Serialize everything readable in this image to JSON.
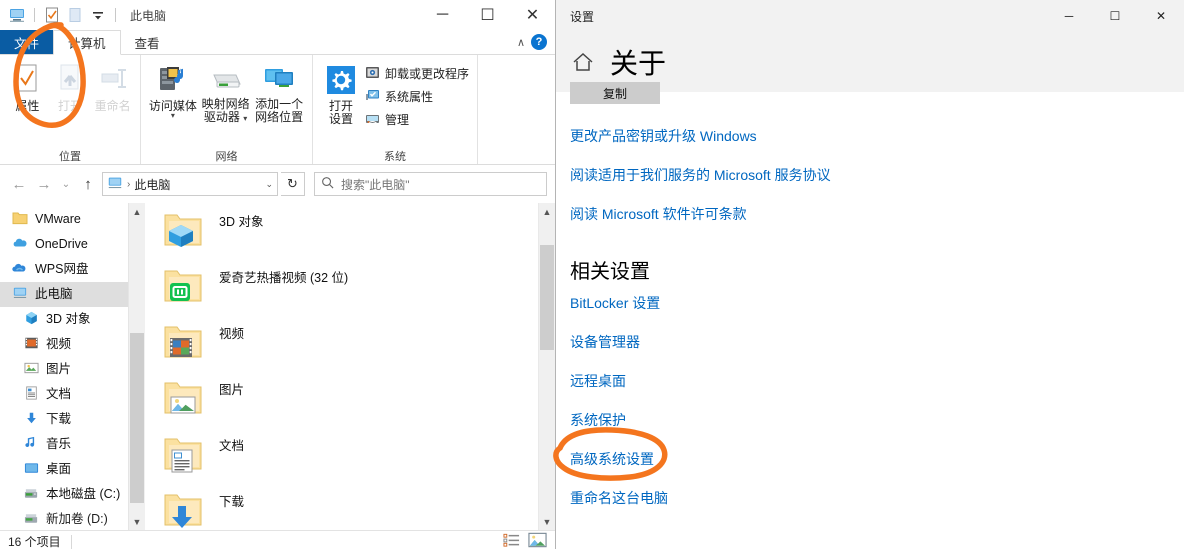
{
  "explorer": {
    "window_title": "此电脑",
    "quick_access_icons": [
      "this-pc-icon",
      "properties-checkbox-icon",
      "new-folder-icon",
      "customize-dropdown-icon"
    ],
    "window_buttons": {
      "minimize": "─",
      "maximize": "☐",
      "close": "✕"
    },
    "tabs": [
      {
        "label": "文件",
        "kind": "file"
      },
      {
        "label": "计算机",
        "kind": "active"
      },
      {
        "label": "查看",
        "kind": "normal"
      }
    ],
    "ribbon_collapse": "∧",
    "help_label": "?",
    "ribbon": {
      "groups": [
        {
          "label": "位置",
          "buttons": [
            {
              "label": "属性",
              "icon": "properties-icon",
              "disabled": false
            },
            {
              "label": "打开",
              "icon": "open-icon",
              "disabled": true
            },
            {
              "label": "重命名",
              "icon": "rename-icon",
              "disabled": true
            }
          ]
        },
        {
          "label": "网络",
          "buttons": [
            {
              "label": "访问媒体",
              "icon": "media-server-icon",
              "disabled": false,
              "dropdown": true
            },
            {
              "label": "映射网络\n驱动器",
              "icon": "map-drive-icon",
              "disabled": false,
              "dropdown": true
            },
            {
              "label": "添加一个\n网络位置",
              "icon": "add-network-location-icon",
              "disabled": false
            }
          ]
        },
        {
          "label": "系统",
          "big": {
            "label": "打开\n设置",
            "icon": "settings-gear-icon"
          },
          "items": [
            {
              "label": "卸载或更改程序",
              "icon": "uninstall-program-icon"
            },
            {
              "label": "系统属性",
              "icon": "system-properties-icon"
            },
            {
              "label": "管理",
              "icon": "manage-icon"
            }
          ]
        }
      ]
    },
    "addressbar": {
      "back": "←",
      "forward": "→",
      "recent": "⌄",
      "up": "↑",
      "path_icon": "this-pc-icon",
      "path": "此电脑",
      "separator": "›",
      "dropdown": "⌄",
      "refresh": "↻",
      "search_placeholder": "搜索\"此电脑\"",
      "search_icon": "search-icon"
    },
    "nav_pane": [
      {
        "label": "VMware",
        "icon": "folder-icon",
        "indent": false,
        "selected": false
      },
      {
        "label": "OneDrive",
        "icon": "onedrive-cloud-icon",
        "indent": false,
        "selected": false
      },
      {
        "label": "WPS网盘",
        "icon": "wps-cloud-icon",
        "indent": false,
        "selected": false
      },
      {
        "label": "此电脑",
        "icon": "this-pc-icon",
        "indent": false,
        "selected": true
      },
      {
        "label": "3D 对象",
        "icon": "3d-objects-icon",
        "indent": true,
        "selected": false
      },
      {
        "label": "视频",
        "icon": "videos-icon",
        "indent": true,
        "selected": false
      },
      {
        "label": "图片",
        "icon": "pictures-icon",
        "indent": true,
        "selected": false
      },
      {
        "label": "文档",
        "icon": "documents-icon",
        "indent": true,
        "selected": false
      },
      {
        "label": "下载",
        "icon": "downloads-icon",
        "indent": true,
        "selected": false
      },
      {
        "label": "音乐",
        "icon": "music-icon",
        "indent": true,
        "selected": false
      },
      {
        "label": "桌面",
        "icon": "desktop-icon",
        "indent": true,
        "selected": false
      },
      {
        "label": "本地磁盘 (C:)",
        "icon": "local-disk-icon",
        "indent": true,
        "selected": false
      },
      {
        "label": "新加卷 (D:)",
        "icon": "local-disk-icon",
        "indent": true,
        "selected": false
      }
    ],
    "file_list": [
      {
        "name": "3D 对象",
        "icon": "folder-3d-objects-icon"
      },
      {
        "name": "爱奇艺热播视频 (32 位)",
        "icon": "folder-iqiyi-icon"
      },
      {
        "name": "视频",
        "icon": "folder-videos-icon"
      },
      {
        "name": "图片",
        "icon": "folder-pictures-icon"
      },
      {
        "name": "文档",
        "icon": "folder-documents-icon"
      },
      {
        "name": "下载",
        "icon": "folder-downloads-icon"
      }
    ],
    "status": {
      "count_label": "16 个项目",
      "view_buttons": [
        "details-view-icon",
        "large-icons-view-icon"
      ]
    }
  },
  "settings": {
    "window_title": "设置",
    "window_buttons": {
      "minimize": "─",
      "maximize": "☐",
      "close": "✕"
    },
    "home_icon": "home-icon",
    "page_title": "关于",
    "copy_button": "复制",
    "links_top": [
      "更改产品密钥或升级 Windows",
      "阅读适用于我们服务的 Microsoft 服务协议",
      "阅读 Microsoft 软件许可条款"
    ],
    "related_settings_title": "相关设置",
    "related_links": [
      "BitLocker 设置",
      "设备管理器",
      "远程桌面",
      "系统保护",
      "高级系统设置",
      "重命名这台电脑"
    ]
  },
  "annotations": {
    "color": "#F4751E",
    "marks": [
      {
        "name": "circle-properties-button"
      },
      {
        "name": "circle-advanced-system-settings-link"
      }
    ]
  },
  "theme": {
    "accent": "#0a5ca3",
    "link": "#0067c0",
    "annotation": "#F4751E",
    "selection": "#dedede"
  }
}
